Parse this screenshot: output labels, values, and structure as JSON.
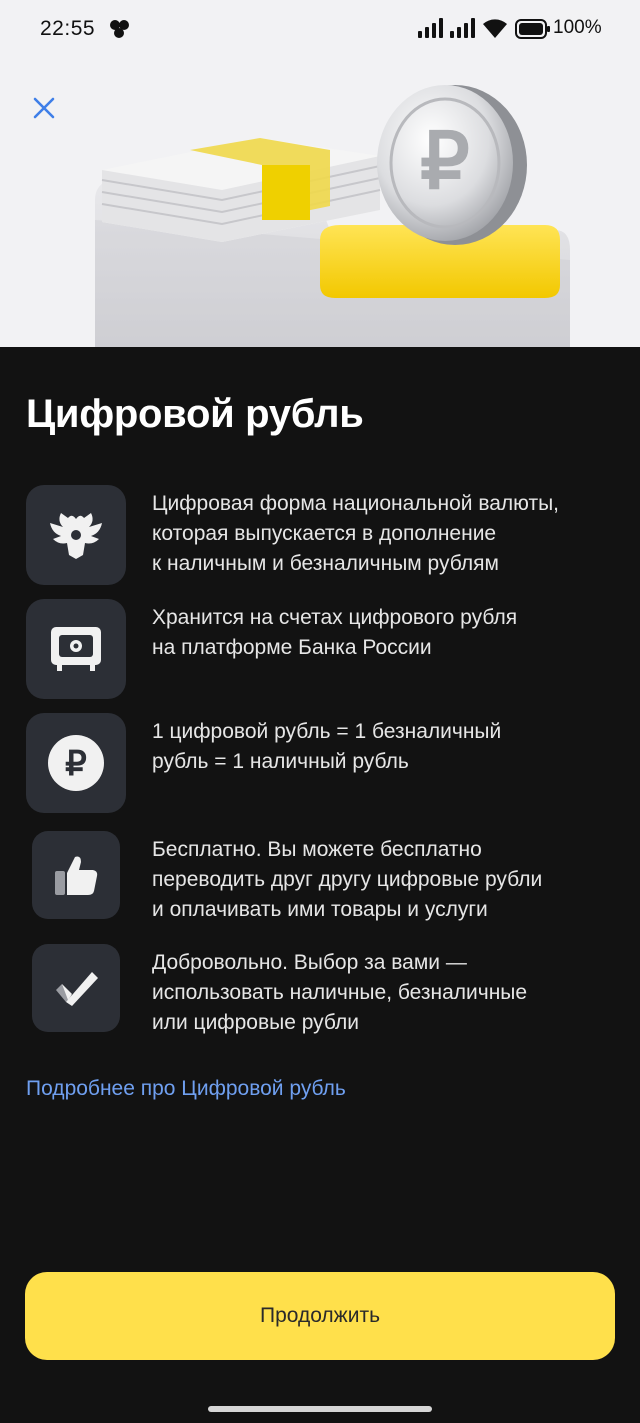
{
  "status_bar": {
    "time": "22:55",
    "battery": "100%"
  },
  "hero": {
    "close_icon": "close-icon",
    "illustration": "coin-and-cash-illustration"
  },
  "title": "Цифровой рубль",
  "features": [
    {
      "icon": "eagle-emblem-icon",
      "text": "Цифровая форма национальной валюты,\nкоторая выпускается в дополнение\nк наличным и безналичным рублям"
    },
    {
      "icon": "safe-icon",
      "text": "Хранится на счетах цифрового рубля\nна платформе Банка России"
    },
    {
      "icon": "ruble-coin-icon",
      "text": "1 цифровой рубль = 1 безналичный\nрубль = 1 наличный рубль"
    },
    {
      "icon": "thumbs-up-icon",
      "text": "Бесплатно. Вы можете бесплатно\nпереводить друг другу цифровые рубли\nи оплачивать ими товары и услуги"
    },
    {
      "icon": "checkmark-icon",
      "text": "Добровольно. Выбор за вами —\nиспользовать наличные, безналичные\nили цифровые рубли"
    }
  ],
  "more_link": "Подробнее про Цифровой рубль",
  "continue_button": "Продолжить",
  "colors": {
    "background": "#121212",
    "hero_background": "#f2f2f4",
    "accent": "#ffe04b",
    "link": "#6f9ff0",
    "icon_tile": "#2c2f36"
  }
}
